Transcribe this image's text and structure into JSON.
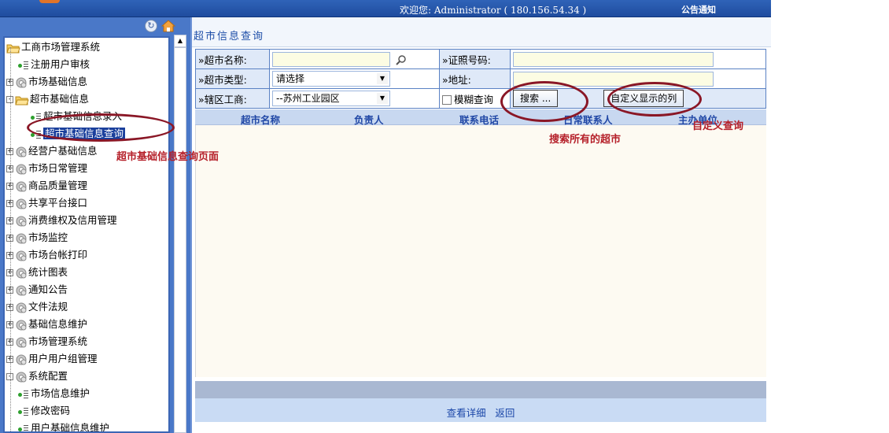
{
  "header": {
    "welcome_text": "欢迎您: Administrator ( 180.156.54.34 )",
    "notice_link": "公告通知"
  },
  "sidebar": {
    "tree": [
      {
        "label": "工商市场管理系统",
        "icon": "folder-open-icon",
        "level": 0
      },
      {
        "label": "注册用户审核",
        "icon": "leaf-doc-icon",
        "level": 1
      },
      {
        "label": "市场基础信息",
        "icon": "gear-icon",
        "level": 0,
        "expander": "+"
      },
      {
        "label": "超市基础信息",
        "icon": "folder-open-icon",
        "level": 0,
        "expander": "-"
      },
      {
        "label": "超市基础信息录入",
        "icon": "leaf-doc-icon",
        "level": 2
      },
      {
        "label": "超市基础信息查询",
        "icon": "leaf-doc-icon",
        "level": 2,
        "selected": true
      },
      {
        "label": "经营户基础信息",
        "icon": "gear-icon",
        "level": 0,
        "expander": "+"
      },
      {
        "label": "市场日常管理",
        "icon": "gear-icon",
        "level": 0,
        "expander": "+"
      },
      {
        "label": "商品质量管理",
        "icon": "gear-icon",
        "level": 0,
        "expander": "+"
      },
      {
        "label": "共享平台接口",
        "icon": "gear-icon",
        "level": 0,
        "expander": "+"
      },
      {
        "label": "消费维权及信用管理",
        "icon": "gear-icon",
        "level": 0,
        "expander": "+"
      },
      {
        "label": "市场监控",
        "icon": "gear-icon",
        "level": 0,
        "expander": "+"
      },
      {
        "label": "市场台帐打印",
        "icon": "gear-icon",
        "level": 0,
        "expander": "+"
      },
      {
        "label": "统计图表",
        "icon": "gear-icon",
        "level": 0,
        "expander": "+"
      },
      {
        "label": "通知公告",
        "icon": "gear-icon",
        "level": 0,
        "expander": "+"
      },
      {
        "label": "文件法规",
        "icon": "gear-icon",
        "level": 0,
        "expander": "+"
      },
      {
        "label": "基础信息维护",
        "icon": "gear-icon",
        "level": 0,
        "expander": "+"
      },
      {
        "label": "市场管理系统",
        "icon": "gear-icon",
        "level": 0,
        "expander": "+"
      },
      {
        "label": "用户用户组管理",
        "icon": "gear-icon",
        "level": 0,
        "expander": "+"
      },
      {
        "label": "系统配置",
        "icon": "gear-icon",
        "level": 0,
        "expander": "-"
      },
      {
        "label": "市场信息维护",
        "icon": "leaf-doc-icon",
        "level": 1
      },
      {
        "label": "修改密码",
        "icon": "leaf-doc-icon",
        "level": 1
      },
      {
        "label": "用户基础信息维护",
        "icon": "leaf-doc-icon",
        "level": 1
      }
    ]
  },
  "main": {
    "section_title": "超市信息查询",
    "search": {
      "name_label": "»超市名称:",
      "name_value": "",
      "license_label": "»证照号码:",
      "license_value": "",
      "type_label": "»超市类型:",
      "type_selected": "请选择",
      "address_label": "»地址:",
      "address_value": "",
      "district_label": "»辖区工商:",
      "district_selected": "--苏州工业园区",
      "fuzzy_label": "模糊查询",
      "search_button": "搜索 ...",
      "custom_columns_button": "自定义显示的列"
    },
    "grid": {
      "columns": [
        "超市名称",
        "负责人",
        "联系电话",
        "日常联系人",
        "主办单位"
      ]
    },
    "actions": {
      "view_detail": "查看详细",
      "back": "返回"
    }
  },
  "annotations": {
    "page_note": "超市基础信息查询页面",
    "search_note": "搜索所有的超市",
    "custom_note": "自定义查询"
  },
  "colors": {
    "topbar": "#2a5bb0",
    "sidebar": "#4a78c8",
    "accent_text": "#1f4fa8",
    "annotation": "#8a1726"
  }
}
